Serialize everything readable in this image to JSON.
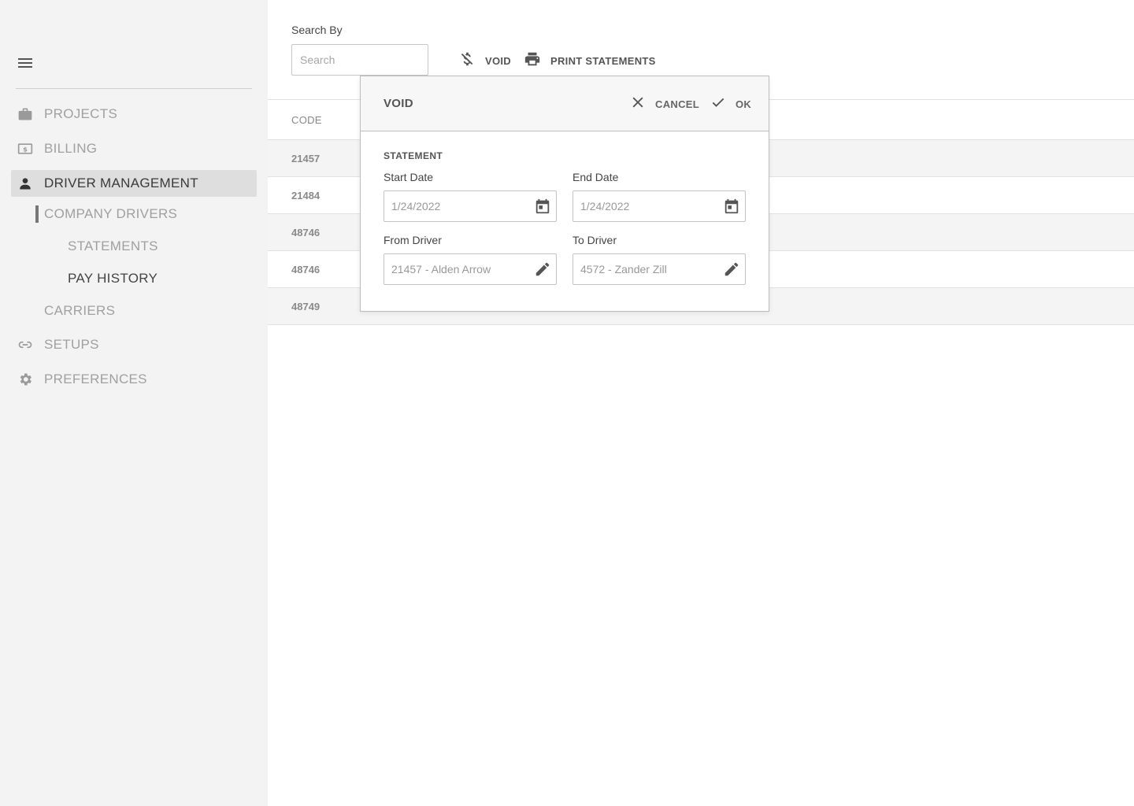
{
  "sidebar": {
    "nav": [
      {
        "label": "PROJECTS",
        "icon": "briefcase-icon"
      },
      {
        "label": "BILLING",
        "icon": "billing-icon"
      },
      {
        "label": "DRIVER MANAGEMENT",
        "icon": "person-icon"
      },
      {
        "label": "SETUPS",
        "icon": "link-icon"
      },
      {
        "label": "PREFERENCES",
        "icon": "gear-icon"
      }
    ],
    "sub": {
      "company_drivers": "COMPANY DRIVERS",
      "statements": "STATEMENTS",
      "pay_history": "PAY HISTORY",
      "carriers": "CARRIERS"
    }
  },
  "toolbar": {
    "search_label": "Search By",
    "search_placeholder": "Search",
    "search_value": "",
    "void_label": "VOID",
    "print_label": "PRINT STATEMENTS"
  },
  "table": {
    "headers": {
      "code": "CODE"
    },
    "rows": [
      {
        "code": "21457"
      },
      {
        "code": "21484"
      },
      {
        "code": "48746"
      },
      {
        "code": "48746"
      },
      {
        "code": "48749"
      }
    ]
  },
  "dialog": {
    "title": "VOID",
    "cancel_label": "CANCEL",
    "ok_label": "OK",
    "section": "STATEMENT",
    "start_date": {
      "label": "Start Date",
      "value": "1/24/2022"
    },
    "end_date": {
      "label": "End Date",
      "value": "1/24/2022"
    },
    "from_driver": {
      "label": "From Driver",
      "value": "21457 - Alden Arrow"
    },
    "to_driver": {
      "label": "To Driver",
      "value": "4572 - Zander Zill"
    }
  },
  "colors": {
    "sidebar_bg": "#f3f3f3",
    "active_item_bg": "#dedede",
    "icon_color": "#6b6b6b",
    "alt_row_bg": "#f4f4f4"
  }
}
